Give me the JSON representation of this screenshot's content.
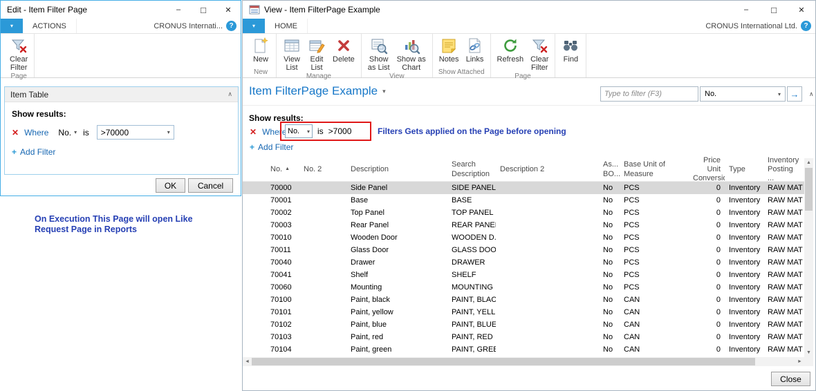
{
  "glyphs": {
    "minimize": "–",
    "maximize": "□",
    "close": "✕",
    "dropdown": "▾",
    "sort_asc": "▲",
    "collapse": "∧",
    "red_x": "✕",
    "plus": "+",
    "go_arrow": "→",
    "help": "?",
    "scroll_up": "▲",
    "scroll_down": "▼",
    "scroll_left": "◄",
    "scroll_right": "►"
  },
  "left_window": {
    "title": "Edit - Item Filter Page",
    "tab": "ACTIONS",
    "company": "CRONUS Internati...",
    "ribbon": {
      "clear_filter_label": "Clear\nFilter",
      "group_label": "Page"
    },
    "panel": {
      "title": "Item Table",
      "show_results": "Show results:",
      "filter": {
        "where": "Where",
        "field": "No.",
        "operator": "is",
        "value": ">70000"
      },
      "add_filter": "Add Filter"
    },
    "ok_button": "OK",
    "cancel_button": "Cancel"
  },
  "note": {
    "line1": "On Execution This Page will open Like",
    "line2": "Request Page in Reports"
  },
  "right_window": {
    "title": "View - Item FilterPage Example",
    "tab": "HOME",
    "company": "CRONUS International Ltd.",
    "ribbon_groups": [
      {
        "label": "New",
        "buttons": [
          {
            "label": "New"
          }
        ]
      },
      {
        "label": "Manage",
        "buttons": [
          {
            "label": "View\nList"
          },
          {
            "label": "Edit\nList"
          },
          {
            "label": "Delete"
          }
        ]
      },
      {
        "label": "View",
        "buttons": [
          {
            "label": "Show\nas List"
          },
          {
            "label": "Show as\nChart"
          }
        ]
      },
      {
        "label": "Show Attached",
        "buttons": [
          {
            "label": "Notes"
          },
          {
            "label": "Links"
          }
        ]
      },
      {
        "label": "Page",
        "buttons": [
          {
            "label": "Refresh"
          },
          {
            "label": "Clear\nFilter"
          }
        ]
      },
      {
        "label": "",
        "buttons": [
          {
            "label": "Find"
          }
        ]
      }
    ],
    "page_title": "Item FilterPage Example",
    "filter_bar": {
      "placeholder": "Type to filter (F3)",
      "column": "No."
    },
    "show_results": "Show results:",
    "filter": {
      "where": "Where",
      "field": "No.",
      "operator": "is",
      "value": ">7000"
    },
    "annotation": "Filters Gets applied on the Page before opening",
    "add_filter": "Add Filter",
    "table": {
      "columns": [
        "No.",
        "No. 2",
        "Description",
        "Search\nDescription",
        "Description 2",
        "As...\nBO...",
        "Base Unit of\nMeasure",
        "Price Unit\nConversion",
        "Type",
        "Inventory\nPosting ..."
      ],
      "rows": [
        {
          "no": "70000",
          "no2": "",
          "description": "Side Panel",
          "search_description": "SIDE PANEL",
          "description2": "",
          "assembly_bom": "No",
          "base_unit": "PCS",
          "price_unit_conversion": "0",
          "type": "Inventory",
          "inventory_posting": "RAW MAT",
          "selected": true
        },
        {
          "no": "70001",
          "no2": "",
          "description": "Base",
          "search_description": "BASE",
          "description2": "",
          "assembly_bom": "No",
          "base_unit": "PCS",
          "price_unit_conversion": "0",
          "type": "Inventory",
          "inventory_posting": "RAW MAT"
        },
        {
          "no": "70002",
          "no2": "",
          "description": "Top Panel",
          "search_description": "TOP PANEL",
          "description2": "",
          "assembly_bom": "No",
          "base_unit": "PCS",
          "price_unit_conversion": "0",
          "type": "Inventory",
          "inventory_posting": "RAW MAT"
        },
        {
          "no": "70003",
          "no2": "",
          "description": "Rear Panel",
          "search_description": "REAR PANEL",
          "description2": "",
          "assembly_bom": "No",
          "base_unit": "PCS",
          "price_unit_conversion": "0",
          "type": "Inventory",
          "inventory_posting": "RAW MAT"
        },
        {
          "no": "70010",
          "no2": "",
          "description": "Wooden Door",
          "search_description": "WOODEN D...",
          "description2": "",
          "assembly_bom": "No",
          "base_unit": "PCS",
          "price_unit_conversion": "0",
          "type": "Inventory",
          "inventory_posting": "RAW MAT"
        },
        {
          "no": "70011",
          "no2": "",
          "description": "Glass Door",
          "search_description": "GLASS DOOR",
          "description2": "",
          "assembly_bom": "No",
          "base_unit": "PCS",
          "price_unit_conversion": "0",
          "type": "Inventory",
          "inventory_posting": "RAW MAT"
        },
        {
          "no": "70040",
          "no2": "",
          "description": "Drawer",
          "search_description": "DRAWER",
          "description2": "",
          "assembly_bom": "No",
          "base_unit": "PCS",
          "price_unit_conversion": "0",
          "type": "Inventory",
          "inventory_posting": "RAW MAT"
        },
        {
          "no": "70041",
          "no2": "",
          "description": "Shelf",
          "search_description": "SHELF",
          "description2": "",
          "assembly_bom": "No",
          "base_unit": "PCS",
          "price_unit_conversion": "0",
          "type": "Inventory",
          "inventory_posting": "RAW MAT"
        },
        {
          "no": "70060",
          "no2": "",
          "description": "Mounting",
          "search_description": "MOUNTING",
          "description2": "",
          "assembly_bom": "No",
          "base_unit": "PCS",
          "price_unit_conversion": "0",
          "type": "Inventory",
          "inventory_posting": "RAW MAT"
        },
        {
          "no": "70100",
          "no2": "",
          "description": "Paint, black",
          "search_description": "PAINT, BLACK",
          "description2": "",
          "assembly_bom": "No",
          "base_unit": "CAN",
          "price_unit_conversion": "0",
          "type": "Inventory",
          "inventory_posting": "RAW MAT"
        },
        {
          "no": "70101",
          "no2": "",
          "description": "Paint, yellow",
          "search_description": "PAINT, YELL...",
          "description2": "",
          "assembly_bom": "No",
          "base_unit": "CAN",
          "price_unit_conversion": "0",
          "type": "Inventory",
          "inventory_posting": "RAW MAT"
        },
        {
          "no": "70102",
          "no2": "",
          "description": "Paint, blue",
          "search_description": "PAINT, BLUE",
          "description2": "",
          "assembly_bom": "No",
          "base_unit": "CAN",
          "price_unit_conversion": "0",
          "type": "Inventory",
          "inventory_posting": "RAW MAT"
        },
        {
          "no": "70103",
          "no2": "",
          "description": "Paint, red",
          "search_description": "PAINT, RED",
          "description2": "",
          "assembly_bom": "No",
          "base_unit": "CAN",
          "price_unit_conversion": "0",
          "type": "Inventory",
          "inventory_posting": "RAW MAT"
        },
        {
          "no": "70104",
          "no2": "",
          "description": "Paint, green",
          "search_description": "PAINT, GREEN",
          "description2": "",
          "assembly_bom": "No",
          "base_unit": "CAN",
          "price_unit_conversion": "0",
          "type": "Inventory",
          "inventory_posting": "RAW MAT"
        }
      ]
    },
    "close_button": "Close"
  }
}
